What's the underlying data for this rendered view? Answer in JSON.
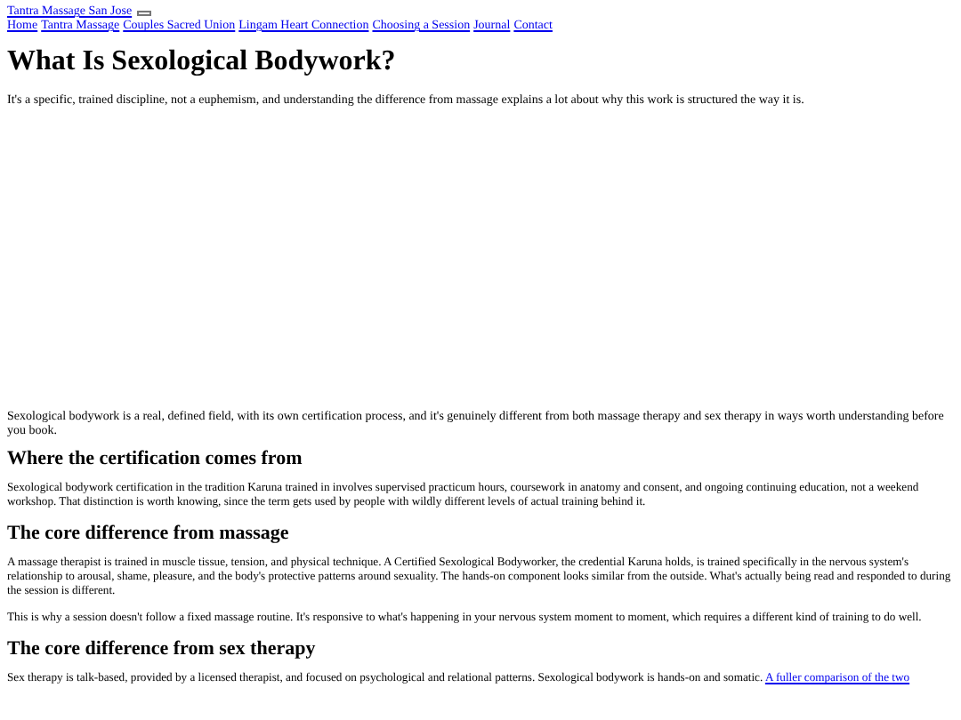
{
  "site_title": "Tantra Massage San Jose",
  "nav": [
    "Home",
    "Tantra Massage",
    "Couples Sacred Union",
    "Lingam Heart Connection",
    "Choosing a Session",
    "Journal",
    "Contact"
  ],
  "title": "What Is Sexological Bodywork?",
  "intro": "It's a specific, trained discipline, not a euphemism, and understanding the difference from massage explains a lot about why this work is structured the way it is.",
  "lead": "Sexological bodywork is a real, defined field, with its own certification process, and it's genuinely different from both massage therapy and sex therapy in ways worth understanding before you book.",
  "sections": [
    {
      "heading": "Where the certification comes from",
      "paragraphs": [
        {
          "text": "Sexological bodywork certification in the tradition Karuna trained in involves supervised practicum hours, coursework in anatomy and consent, and ongoing continuing education, not a weekend workshop. That distinction is worth knowing, since the term gets used by people with wildly different levels of actual training behind it."
        }
      ]
    },
    {
      "heading": "The core difference from massage",
      "paragraphs": [
        {
          "text": "A massage therapist is trained in muscle tissue, tension, and physical technique. A Certified Sexological Bodyworker, the credential Karuna holds, is trained specifically in the nervous system's relationship to arousal, shame, pleasure, and the body's protective patterns around sexuality. The hands-on component looks similar from the outside. What's actually being read and responded to during the session is different."
        },
        {
          "text": "This is why a session doesn't follow a fixed massage routine. It's responsive to what's happening in your nervous system moment to moment, which requires a different kind of training to do well."
        }
      ]
    },
    {
      "heading": "The core difference from sex therapy",
      "paragraphs": [
        {
          "text": "Sex therapy is talk-based, provided by a licensed therapist, and focused on psychological and relational patterns. Sexological bodywork is hands-on and somatic.",
          "link": "A fuller comparison of the two"
        }
      ]
    }
  ]
}
